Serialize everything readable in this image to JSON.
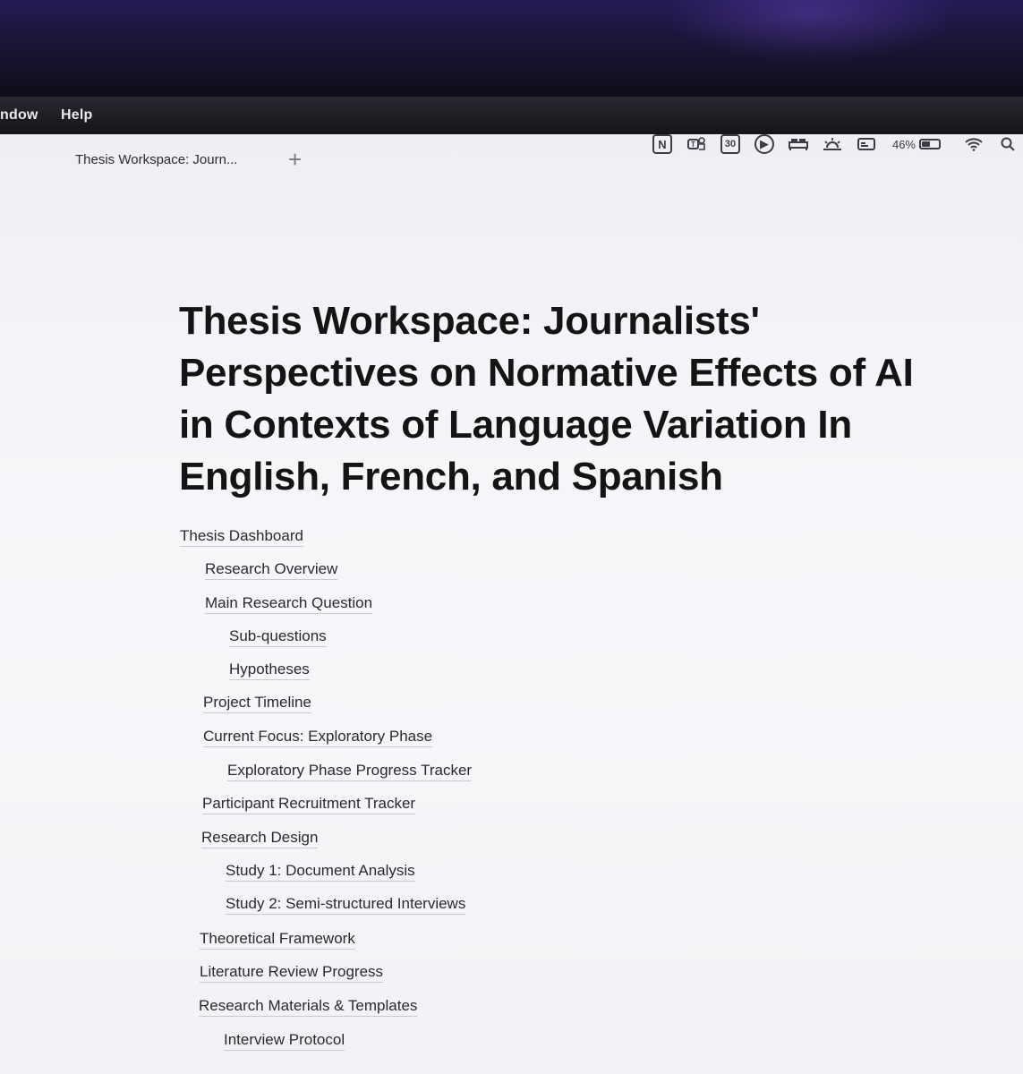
{
  "menubar": {
    "items": [
      "ndow",
      "Help"
    ],
    "status": {
      "icons": [
        "notion-icon",
        "teams-icon",
        "calendar-icon",
        "play-icon",
        "bed-icon",
        "brightness-icon",
        "display-icon"
      ],
      "calendar_day": "30",
      "notion_letter": "N",
      "battery_percent": "46%",
      "battery_level": 0.46
    }
  },
  "tabs": [
    {
      "label": "Thesis Workspace: Journ..."
    }
  ],
  "page": {
    "title": "Thesis Workspace: Journalists' Perspectives on Normative Effects of AI in Contexts of Language Variation In English, French, and Spanish"
  },
  "toc": [
    {
      "label": "Thesis Dashboard",
      "level": 0
    },
    {
      "label": "Research Overview",
      "level": 1
    },
    {
      "label": "Main Research Question",
      "level": 1
    },
    {
      "label": "Sub-questions",
      "level": 2
    },
    {
      "label": "Hypotheses",
      "level": 2
    },
    {
      "label": "Project Timeline",
      "level": 1
    },
    {
      "label": "Current Focus: Exploratory Phase",
      "level": 1
    },
    {
      "label": "Exploratory Phase Progress Tracker",
      "level": 2
    },
    {
      "label": "Participant Recruitment Tracker",
      "level": 1
    },
    {
      "label": "Research Design",
      "level": 1
    },
    {
      "label": "Study 1: Document Analysis",
      "level": 2
    },
    {
      "label": "Study 2: Semi-structured Interviews",
      "level": 2
    },
    {
      "label": "Theoretical Framework",
      "level": 1
    },
    {
      "label": "Literature Review Progress",
      "level": 1
    },
    {
      "label": "Research Materials & Templates",
      "level": 1
    },
    {
      "label": "Interview Protocol",
      "level": 2
    }
  ]
}
